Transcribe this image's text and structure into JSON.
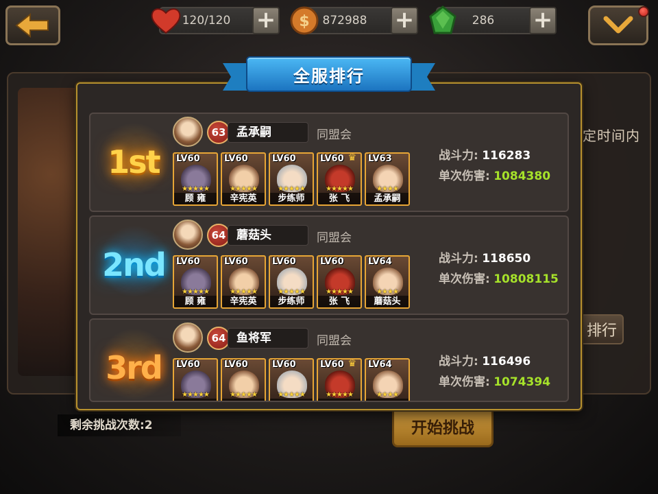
{
  "hud": {
    "hearts": "120/120",
    "gold": "872988",
    "gems": "286",
    "colors": {
      "heart": "#d23a2a",
      "gold": "#d47a2a",
      "gem": "#3aa03a"
    }
  },
  "background": {
    "partial_text": "定时间内",
    "rank_button": "排行",
    "remaining_challenges": "剩余挑战次数:2",
    "start_button": "开始挑战"
  },
  "modal": {
    "title": "全服排行",
    "entries": [
      {
        "rank_label": "1st",
        "level": "63",
        "name": "孟承嗣",
        "alliance": "同盟会",
        "power_label": "战斗力:",
        "power": "116283",
        "damage_label": "单次伤害:",
        "damage": "1084380",
        "heroes": [
          {
            "level": "LV60",
            "name": "顾  雍",
            "stars": "★★★★★",
            "crown": false
          },
          {
            "level": "LV60",
            "name": "辛宪英",
            "stars": "★★★★★",
            "crown": false
          },
          {
            "level": "LV60",
            "name": "步练师",
            "stars": "★★★★★",
            "crown": false
          },
          {
            "level": "LV60",
            "name": "张  飞",
            "stars": "★★★★★",
            "crown": true
          },
          {
            "level": "LV63",
            "name": "孟承嗣",
            "stars": "★★★★",
            "crown": false
          }
        ]
      },
      {
        "rank_label": "2nd",
        "level": "64",
        "name": "蘑菇头",
        "alliance": "同盟会",
        "power_label": "战斗力:",
        "power": "118650",
        "damage_label": "单次伤害:",
        "damage": "10808115",
        "heroes": [
          {
            "level": "LV60",
            "name": "顾  雍",
            "stars": "★★★★★",
            "crown": false
          },
          {
            "level": "LV60",
            "name": "辛宪英",
            "stars": "★★★★★",
            "crown": false
          },
          {
            "level": "LV60",
            "name": "步练师",
            "stars": "★★★★★",
            "crown": false
          },
          {
            "level": "LV60",
            "name": "张  飞",
            "stars": "★★★★★",
            "crown": false
          },
          {
            "level": "LV64",
            "name": "蘑菇头",
            "stars": "★★★★",
            "crown": false
          }
        ]
      },
      {
        "rank_label": "3rd",
        "level": "64",
        "name": "鱼将军",
        "alliance": "同盟会",
        "power_label": "战斗力:",
        "power": "116496",
        "damage_label": "单次伤害:",
        "damage": "1074394",
        "heroes": [
          {
            "level": "LV60",
            "name": "",
            "stars": "★★★★★",
            "crown": false
          },
          {
            "level": "LV60",
            "name": "",
            "stars": "★★★★★",
            "crown": false
          },
          {
            "level": "LV60",
            "name": "",
            "stars": "★★★★★",
            "crown": false
          },
          {
            "level": "LV60",
            "name": "",
            "stars": "★★★★★",
            "crown": true
          },
          {
            "level": "LV64",
            "name": "",
            "stars": "★★★★",
            "crown": false
          }
        ]
      }
    ]
  }
}
